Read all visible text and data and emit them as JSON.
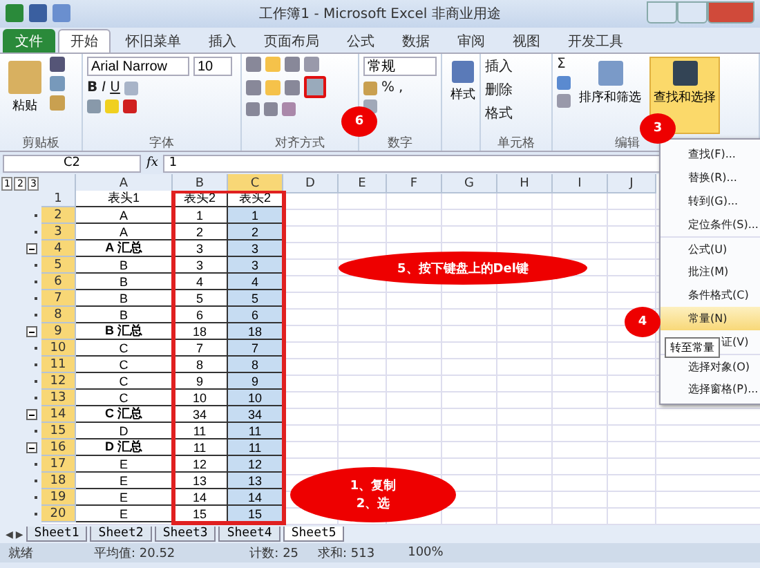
{
  "window": {
    "title": "工作簿1 - Microsoft Excel 非商业用途"
  },
  "tabs": [
    {
      "label": "文件",
      "kind": "file",
      "selected": false
    },
    {
      "label": "开始",
      "kind": "tab",
      "selected": true
    },
    {
      "label": "怀旧菜单",
      "kind": "tab",
      "selected": false
    },
    {
      "label": "插入",
      "kind": "tab",
      "selected": false
    },
    {
      "label": "页面布局",
      "kind": "tab",
      "selected": false
    },
    {
      "label": "公式",
      "kind": "tab",
      "selected": false
    },
    {
      "label": "数据",
      "kind": "tab",
      "selected": false
    },
    {
      "label": "审阅",
      "kind": "tab",
      "selected": false
    },
    {
      "label": "视图",
      "kind": "tab",
      "selected": false
    },
    {
      "label": "开发工具",
      "kind": "tab",
      "selected": false
    }
  ],
  "ribbon": {
    "paste": "粘贴",
    "font_name": "Arial Narrow",
    "font_size": "10",
    "bold": "B",
    "italic": "I",
    "underline": "U",
    "number_format": "常规",
    "percent": "%",
    "comma": ",",
    "styles": "样式",
    "insert": "插入",
    "delete": "删除",
    "format": "格式",
    "sigma": "Σ",
    "sort": "排序和筛选",
    "find": "查找和选择",
    "groups": [
      "剪贴板",
      "字体",
      "对齐方式",
      "数字",
      "单元格",
      "编辑"
    ]
  },
  "formula_bar": {
    "name_box": "C2",
    "fx": "fx",
    "value": "1"
  },
  "sheet_nav": [
    "◀",
    "▶"
  ],
  "columns": [
    {
      "label": "A",
      "selected": false
    },
    {
      "label": "B",
      "selected": false
    },
    {
      "label": "C",
      "selected": true
    },
    {
      "label": "D",
      "selected": false
    },
    {
      "label": "E",
      "selected": false
    },
    {
      "label": "F",
      "selected": false
    },
    {
      "label": "G",
      "selected": false
    },
    {
      "label": "H",
      "selected": false
    },
    {
      "label": "I",
      "selected": false
    },
    {
      "label": "J",
      "selected": false
    }
  ],
  "outline_levels": [
    "1",
    "2",
    "3"
  ],
  "rows": [
    {
      "n": "1",
      "kind": "header",
      "selected": false,
      "cells": [
        "表头1",
        "表头2",
        "表头2"
      ]
    },
    {
      "n": "2",
      "kind": "data",
      "selected": true,
      "cells": [
        "A",
        "1",
        "1"
      ]
    },
    {
      "n": "3",
      "kind": "data",
      "selected": true,
      "cells": [
        "A",
        "2",
        "2"
      ]
    },
    {
      "n": "4",
      "kind": "total",
      "selected": true,
      "cells": [
        "A 汇总",
        "3",
        "3"
      ]
    },
    {
      "n": "5",
      "kind": "data",
      "selected": true,
      "cells": [
        "B",
        "3",
        "3"
      ]
    },
    {
      "n": "6",
      "kind": "data",
      "selected": true,
      "cells": [
        "B",
        "4",
        "4"
      ]
    },
    {
      "n": "7",
      "kind": "data",
      "selected": true,
      "cells": [
        "B",
        "5",
        "5"
      ]
    },
    {
      "n": "8",
      "kind": "data",
      "selected": true,
      "cells": [
        "B",
        "6",
        "6"
      ]
    },
    {
      "n": "9",
      "kind": "total",
      "selected": true,
      "cells": [
        "B 汇总",
        "18",
        "18"
      ]
    },
    {
      "n": "10",
      "kind": "data",
      "selected": true,
      "cells": [
        "C",
        "7",
        "7"
      ]
    },
    {
      "n": "11",
      "kind": "data",
      "selected": true,
      "cells": [
        "C",
        "8",
        "8"
      ]
    },
    {
      "n": "12",
      "kind": "data",
      "selected": true,
      "cells": [
        "C",
        "9",
        "9"
      ]
    },
    {
      "n": "13",
      "kind": "data",
      "selected": true,
      "cells": [
        "C",
        "10",
        "10"
      ]
    },
    {
      "n": "14",
      "kind": "total",
      "selected": true,
      "cells": [
        "C 汇总",
        "34",
        "34"
      ]
    },
    {
      "n": "15",
      "kind": "data",
      "selected": true,
      "cells": [
        "D",
        "11",
        "11"
      ]
    },
    {
      "n": "16",
      "kind": "total",
      "selected": true,
      "cells": [
        "D 汇总",
        "11",
        "11"
      ]
    },
    {
      "n": "17",
      "kind": "data",
      "selected": true,
      "cells": [
        "E",
        "12",
        "12"
      ]
    },
    {
      "n": "18",
      "kind": "data",
      "selected": true,
      "cells": [
        "E",
        "13",
        "13"
      ]
    },
    {
      "n": "19",
      "kind": "data",
      "selected": true,
      "cells": [
        "E",
        "14",
        "14"
      ]
    },
    {
      "n": "20",
      "kind": "data",
      "selected": true,
      "cells": [
        "E",
        "15",
        "15"
      ]
    }
  ],
  "sheet_tabs": [
    {
      "label": "Sheet1",
      "selected": false
    },
    {
      "label": "Sheet2",
      "selected": false
    },
    {
      "label": "Sheet3",
      "selected": false
    },
    {
      "label": "Sheet4",
      "selected": false
    },
    {
      "label": "Sheet5",
      "selected": true
    }
  ],
  "status_bar": {
    "ready": "就绪",
    "average": "平均值: 20.52",
    "count": "计数: 25",
    "sum": "求和: 513",
    "zoom": "100%"
  },
  "menu": [
    {
      "label": "查找(F)...",
      "selected": false
    },
    {
      "label": "替换(R)...",
      "selected": false
    },
    {
      "label": "转到(G)...",
      "selected": false
    },
    {
      "label": "定位条件(S)...",
      "selected": false
    },
    {
      "label": "公式(U)",
      "selected": false
    },
    {
      "label": "批注(M)",
      "selected": false
    },
    {
      "label": "条件格式(C)",
      "selected": false
    },
    {
      "label": "常量(N)",
      "selected": true
    },
    {
      "label": "证(V)",
      "selected": false
    },
    {
      "label": "选择对象(O)",
      "selected": false
    },
    {
      "label": "选择窗格(P)...",
      "selected": false
    }
  ],
  "tooltip": "转至常量",
  "callouts": [
    {
      "label": "3"
    },
    {
      "label": "4"
    },
    {
      "label": "6"
    }
  ],
  "notes": [
    {
      "text": "5、按下键盘上的Del键"
    },
    {
      "text": "1、复制"
    },
    {
      "text": "2、选"
    }
  ]
}
